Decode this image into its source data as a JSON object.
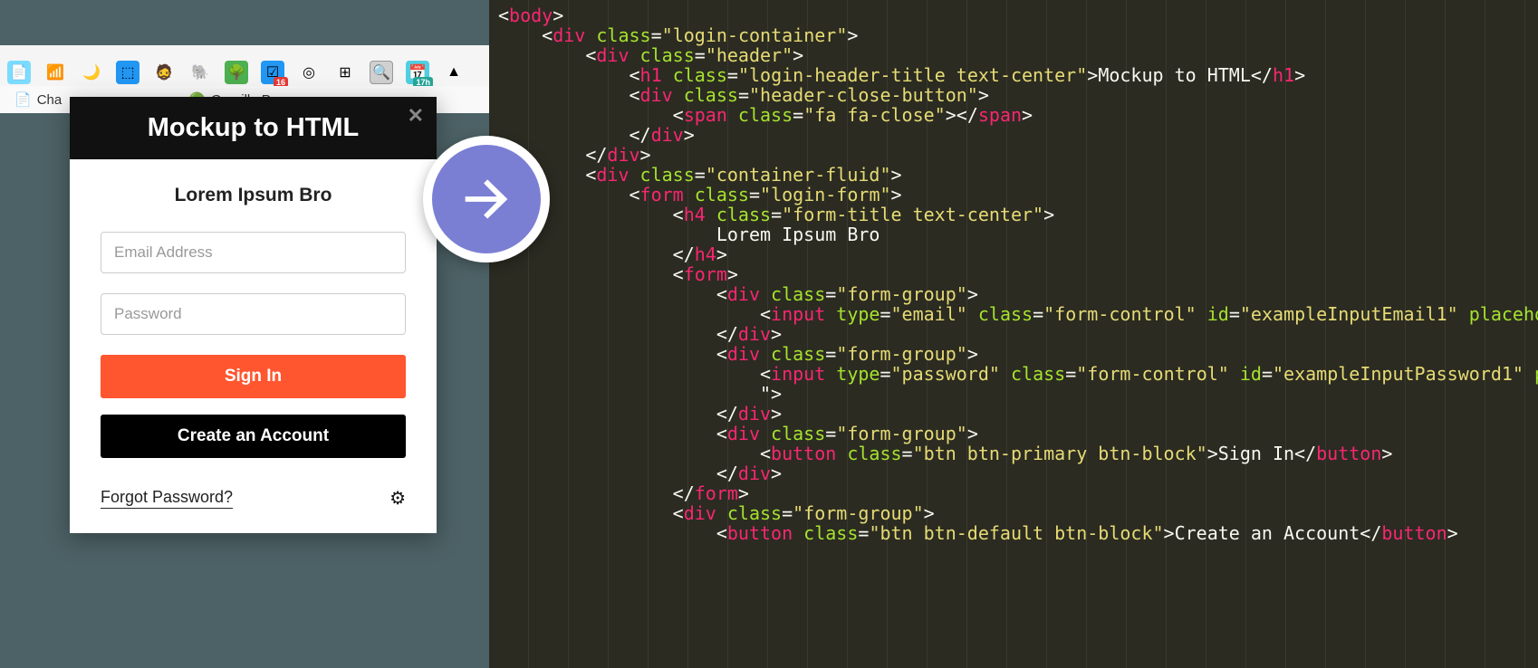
{
  "toolbar": {
    "extensions": [
      {
        "name": "copy-icon",
        "glyph": "📄",
        "bg": "#7bdcff"
      },
      {
        "name": "cast-icon",
        "glyph": "📶",
        "bg": ""
      },
      {
        "name": "moon-icon",
        "glyph": "🌙",
        "bg": ""
      },
      {
        "name": "trello-icon",
        "glyph": "⬚",
        "bg": "#2196f3"
      },
      {
        "name": "avatar-icon",
        "glyph": "🧔",
        "bg": ""
      },
      {
        "name": "evernote-icon",
        "glyph": "🐘",
        "bg": ""
      },
      {
        "name": "forest-icon",
        "glyph": "🌳",
        "bg": "#4caf50"
      },
      {
        "name": "todoist-icon",
        "glyph": "☑",
        "bg": "#2196f3",
        "badge": "16"
      },
      {
        "name": "target-icon",
        "glyph": "◎",
        "bg": ""
      },
      {
        "name": "grid-icon",
        "glyph": "⊞",
        "bg": ""
      },
      {
        "name": "magnify-icon",
        "glyph": "🔍",
        "bg": "",
        "active": true
      },
      {
        "name": "calendar-icon",
        "glyph": "📅",
        "bg": "#4dd0e1",
        "badge_teal": "17h"
      },
      {
        "name": "drive-icon",
        "glyph": "▲",
        "bg": ""
      }
    ],
    "tabs": [
      {
        "label": "Cha",
        "icon": "📄"
      },
      {
        "label": "Guerilla P",
        "icon": "🟢"
      }
    ]
  },
  "login": {
    "header_title": "Mockup to HTML",
    "close_glyph": "✕",
    "form_title": "Lorem Ipsum Bro",
    "email_placeholder": "Email Address",
    "password_placeholder": "Password",
    "signin_label": "Sign In",
    "create_label": "Create an Account",
    "forgot_label": "Forgot Password?",
    "gear_glyph": "⚙"
  },
  "code": {
    "lines": [
      {
        "indent": 0,
        "open": "body",
        "attrs": [],
        "close": false,
        "selfclose": false
      },
      {
        "indent": 1,
        "open": "div",
        "attrs": [
          [
            "class",
            "login-container"
          ]
        ],
        "close": false
      },
      {
        "indent": 2,
        "open": "div",
        "attrs": [
          [
            "class",
            "header"
          ]
        ],
        "close": false
      },
      {
        "indent": 3,
        "open": "h1",
        "attrs": [
          [
            "class",
            "login-header-title text-center"
          ]
        ],
        "text": "Mockup to HTML",
        "closeTag": "h1"
      },
      {
        "indent": 3,
        "open": "div",
        "attrs": [
          [
            "class",
            "header-close-button"
          ]
        ],
        "close": false
      },
      {
        "indent": 4,
        "open": "span",
        "attrs": [
          [
            "class",
            "fa fa-close"
          ]
        ],
        "text": "",
        "closeTag": "span"
      },
      {
        "indent": 3,
        "closeOnly": "div"
      },
      {
        "indent": 2,
        "closeOnly": "div"
      },
      {
        "indent": 2,
        "open": "div",
        "attrs": [
          [
            "class",
            "container-fluid"
          ]
        ],
        "close": false
      },
      {
        "indent": 3,
        "open": "form",
        "attrs": [
          [
            "class",
            "login-form"
          ]
        ],
        "close": false
      },
      {
        "indent": 4,
        "open": "h4",
        "attrs": [
          [
            "class",
            "form-title text-center"
          ]
        ],
        "close": false
      },
      {
        "indent": 5,
        "textOnly": "Lorem Ipsum Bro"
      },
      {
        "indent": 4,
        "closeOnly": "h4"
      },
      {
        "indent": 4,
        "open": "form",
        "attrs": [],
        "close": false
      },
      {
        "indent": 5,
        "open": "div",
        "attrs": [
          [
            "class",
            "form-group"
          ]
        ],
        "close": false
      },
      {
        "indent": 6,
        "open": "input",
        "attrs": [
          [
            "type",
            "email"
          ],
          [
            "class",
            "form-control"
          ],
          [
            "id",
            "exampleInputEmail1"
          ],
          [
            "placehol",
            ""
          ]
        ],
        "truncated": true
      },
      {
        "indent": 5,
        "closeOnly": "div"
      },
      {
        "indent": 5,
        "open": "div",
        "attrs": [
          [
            "class",
            "form-group"
          ]
        ],
        "close": false
      },
      {
        "indent": 6,
        "open": "input",
        "attrs": [
          [
            "type",
            "password"
          ],
          [
            "class",
            "form-control"
          ],
          [
            "id",
            "exampleInputPassword1"
          ],
          [
            "pl",
            ""
          ]
        ],
        "truncated": true
      },
      {
        "indent": 6,
        "textOnly": "\">"
      },
      {
        "indent": 5,
        "closeOnly": "div"
      },
      {
        "indent": 5,
        "open": "div",
        "attrs": [
          [
            "class",
            "form-group"
          ]
        ],
        "close": false
      },
      {
        "indent": 6,
        "open": "button",
        "attrs": [
          [
            "class",
            "btn btn-primary btn-block"
          ]
        ],
        "text": "Sign In",
        "closeTag": "button"
      },
      {
        "indent": 5,
        "closeOnly": "div"
      },
      {
        "indent": 0,
        "blank": true
      },
      {
        "indent": 4,
        "closeOnly": "form"
      },
      {
        "indent": 4,
        "open": "div",
        "attrs": [
          [
            "class",
            "form-group"
          ]
        ],
        "close": false
      },
      {
        "indent": 5,
        "open": "button",
        "attrs": [
          [
            "class",
            "btn btn-default btn-block"
          ]
        ],
        "text": "Create an Account",
        "closeTag": "button"
      }
    ]
  }
}
